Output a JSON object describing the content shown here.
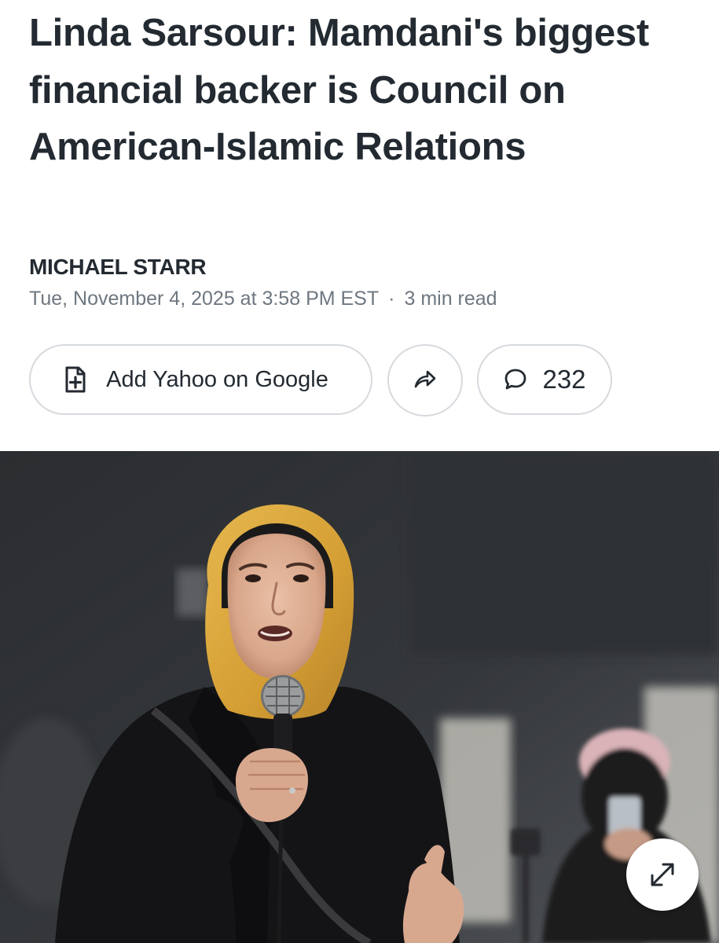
{
  "article": {
    "headline": "Linda Sarsour: Mamdani's biggest financial backer is Council on American-Islamic Relations",
    "author": "MICHAEL STARR",
    "date": "Tue, November 4, 2025 at 3:58 PM EST",
    "separator": "·",
    "read_time": "3 min read"
  },
  "actions": {
    "add_yahoo_label": "Add Yahoo on Google",
    "comment_count": "232",
    "icons": {
      "add": "add-document-icon",
      "share": "share-arrow-icon",
      "comment": "comment-bubble-icon",
      "expand": "expand-arrows-icon"
    }
  },
  "colors": {
    "text": "#232a31",
    "meta_text": "#6e7780",
    "pill_border": "#d6dade",
    "hijab": "#d9a63a"
  }
}
